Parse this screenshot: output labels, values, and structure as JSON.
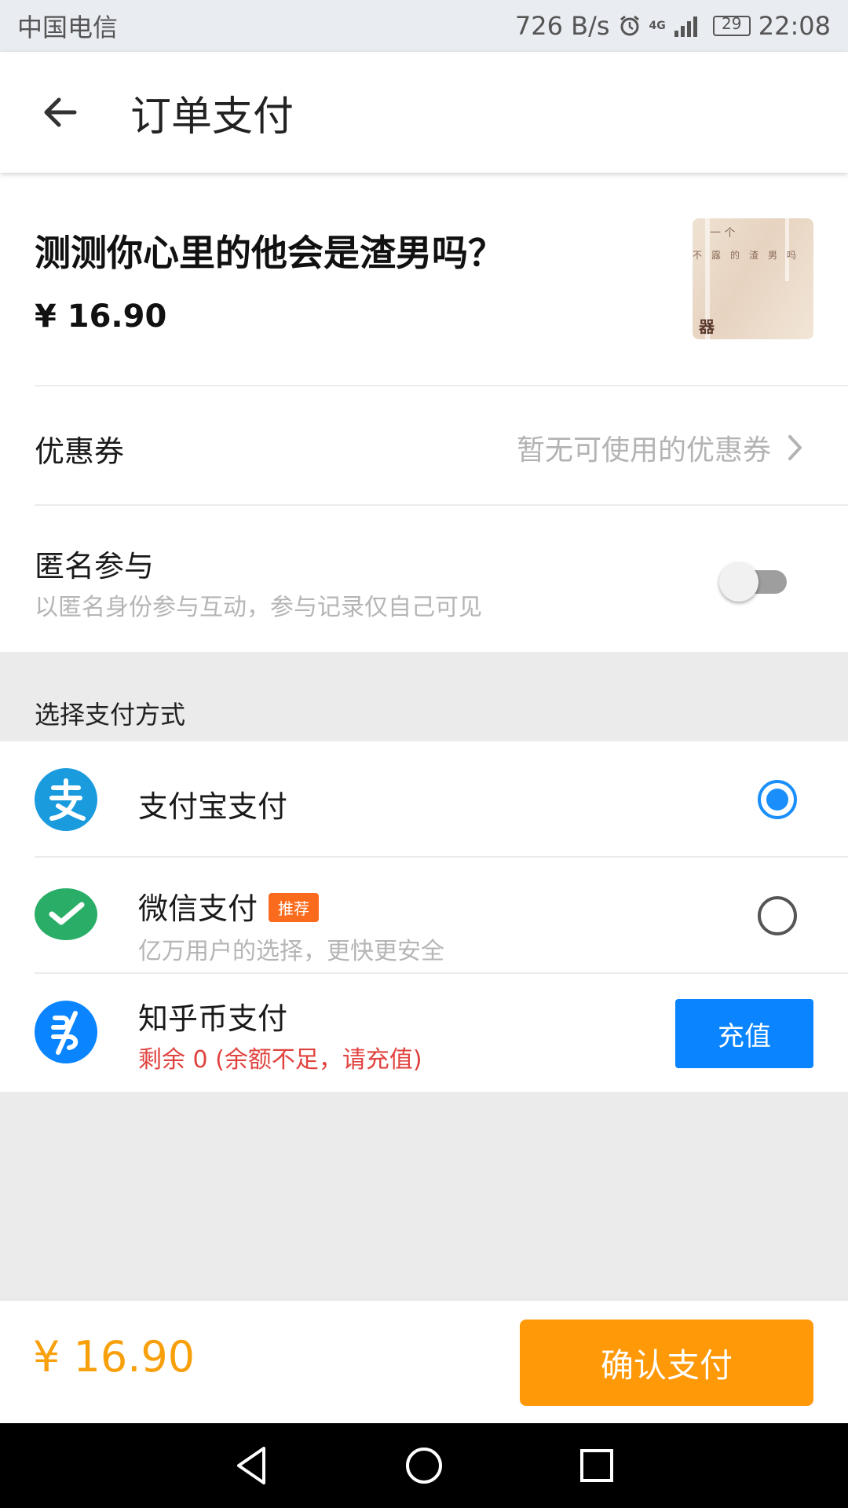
{
  "status_bar": {
    "carrier": "中国电信",
    "net_speed": "726 B/s",
    "network": "4G",
    "battery": "29",
    "time": "22:08"
  },
  "header": {
    "title": "订单支付"
  },
  "product": {
    "title": "测测你心里的他会是渣男吗？",
    "price": "¥ 16.90",
    "thumb_text_top": "一 个",
    "thumb_text_mid": "不露的渣男吗",
    "thumb_text_bottom": "器"
  },
  "coupon": {
    "label": "优惠券",
    "value": "暂无可使用的优惠券"
  },
  "anonymous": {
    "label": "匿名参与",
    "description": "以匿名身份参与互动，参与记录仅自己可见",
    "enabled": false
  },
  "payment": {
    "section_label": "选择支付方式",
    "methods": [
      {
        "name": "支付宝支付",
        "selected": true
      },
      {
        "name": "微信支付",
        "badge": "推荐",
        "description": "亿万用户的选择，更快更安全",
        "selected": false
      },
      {
        "name": "知乎币支付",
        "description": "剩余 0 (余额不足，请充值)",
        "action": "充值"
      }
    ]
  },
  "footer": {
    "total": "¥ 16.90",
    "confirm_label": "确认支付"
  },
  "colors": {
    "accent_orange": "#ff9908",
    "alipay_blue": "#1a9bde",
    "wechat_green": "#2aae67",
    "zhihu_blue": "#0a84ff",
    "warning_red": "#e0433f",
    "badge_orange": "#fb6b1d"
  }
}
